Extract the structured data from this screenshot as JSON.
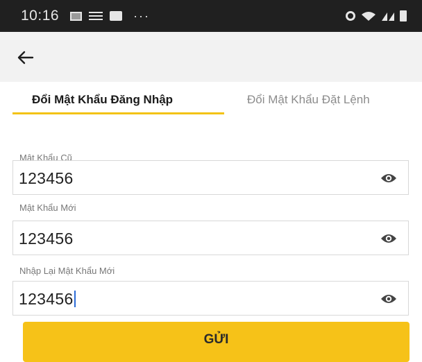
{
  "status_bar": {
    "time": "10:16",
    "more": "···"
  },
  "header": {
    "back_icon": "arrow-left-icon"
  },
  "tabs": [
    {
      "label": "Đổi Mật Khẩu Đăng Nhập",
      "active": true
    },
    {
      "label": "Đổi Mật Khẩu Đặt Lệnh",
      "active": false
    }
  ],
  "form": {
    "old_password": {
      "label": "Mật Khẩu Cũ",
      "value": "123456",
      "icon": "eye-icon"
    },
    "new_password": {
      "label": "Mật Khẩu Mới",
      "value": "123456",
      "icon": "eye-icon"
    },
    "confirm_password": {
      "label": "Nhập Lại Mật Khẩu Mới",
      "value": "123456",
      "icon": "eye-icon"
    }
  },
  "submit": {
    "label": "GỬI"
  },
  "colors": {
    "accent": "#f6c218",
    "status_bar": "#202020",
    "app_bar": "#f2f2f2"
  }
}
